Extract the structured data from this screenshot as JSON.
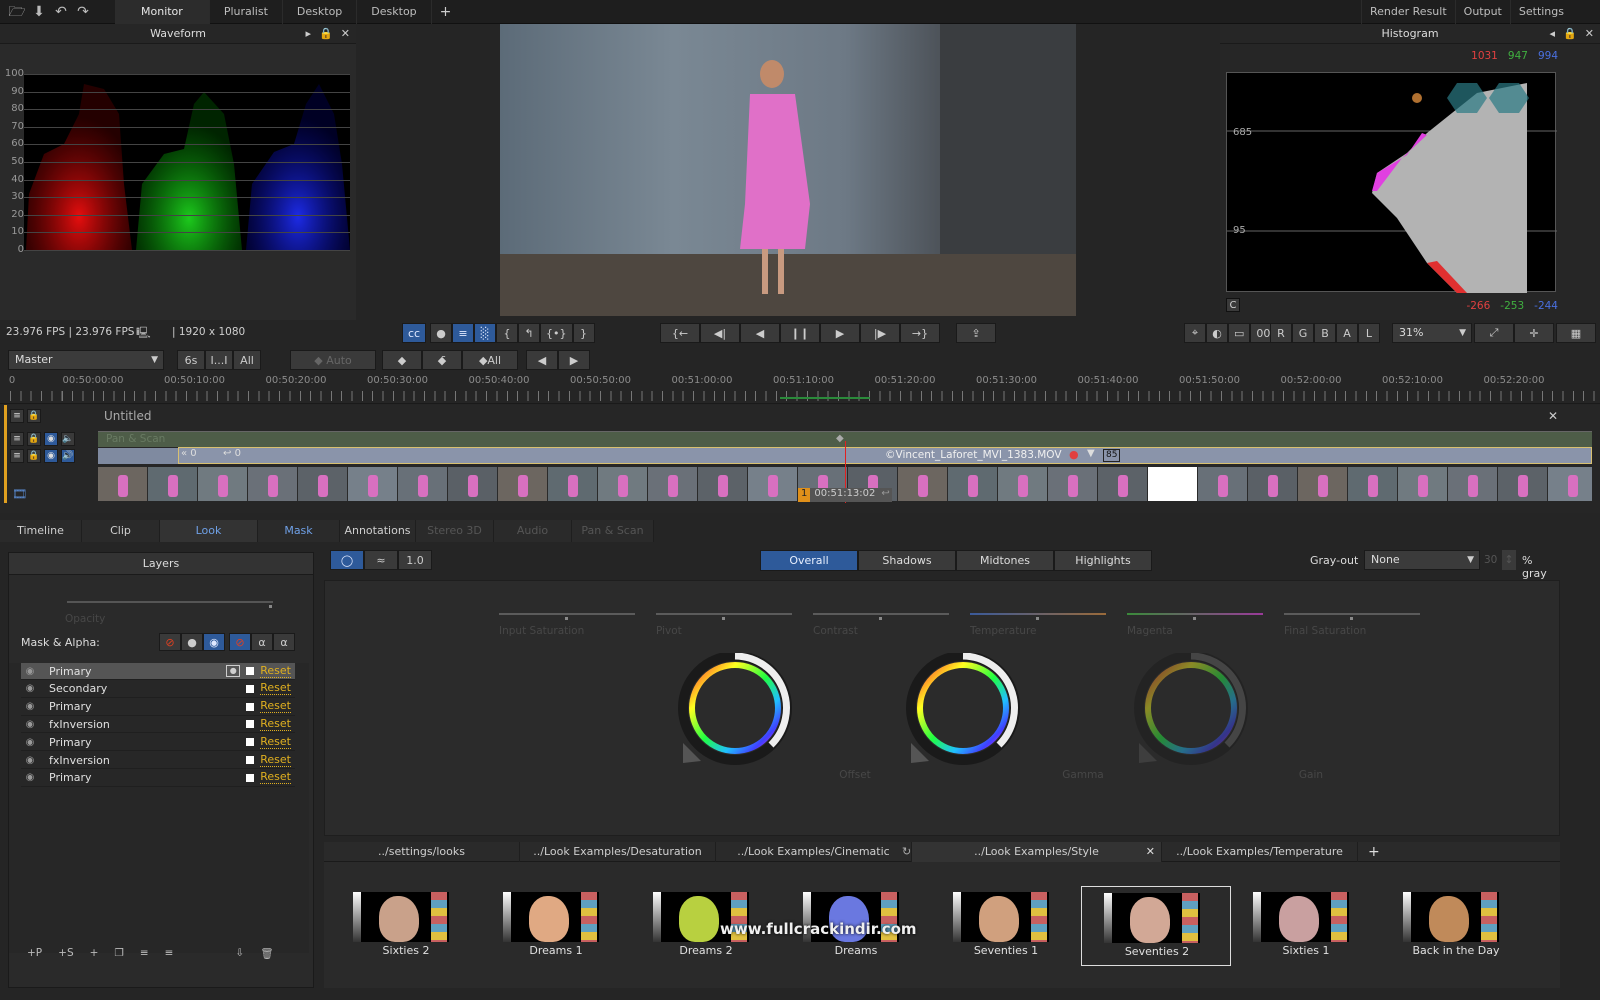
{
  "app": {
    "workspace_tabs": [
      "Monitor",
      "Pluralist",
      "Desktop",
      "Desktop"
    ],
    "active_workspace": "Monitor",
    "right_tabs": [
      "Render Result",
      "Output",
      "Settings"
    ]
  },
  "waveform": {
    "title": "Waveform",
    "scale": [
      "100",
      "90",
      "80",
      "70",
      "60",
      "50",
      "40",
      "30",
      "20",
      "10",
      "0"
    ]
  },
  "histogram": {
    "title": "Histogram",
    "top_values": {
      "r": "1031",
      "g": "947",
      "b": "994"
    },
    "bottom_values": {
      "r": "-266",
      "g": "-253",
      "b": "-244"
    },
    "marks": [
      "685",
      "95"
    ],
    "c_button": "C",
    "colors": {
      "r": "#e04040",
      "g": "#40b040",
      "b": "#4a70e0"
    }
  },
  "status": {
    "fps": "23.976 FPS  |  23.976 FPS",
    "resolution": "|  1920 x 1080",
    "channels": [
      "R",
      "G",
      "B",
      "A",
      "L"
    ],
    "zoom": "31%"
  },
  "keyframes": {
    "layer_select": "Master",
    "range_buttons": [
      "6s",
      "I...I",
      "All"
    ],
    "auto_label": "Auto",
    "all_label": "All"
  },
  "ruler": {
    "labels": [
      "0",
      "00:50:00:00",
      "00:50:10:00",
      "00:50:20:00",
      "00:50:30:00",
      "00:50:40:00",
      "00:50:50:00",
      "00:51:00:00",
      "00:51:10:00",
      "00:51:20:00",
      "00:51:30:00",
      "00:51:40:00",
      "00:51:50:00",
      "00:52:00:00",
      "00:52:10:00",
      "00:52:20:00"
    ]
  },
  "timeline": {
    "name": "Untitled",
    "pan_scan_label": "Pan & Scan",
    "clip_name": "©Vincent_Laforet_MVI_1383.MOV",
    "clip_badge": "85",
    "clip_offset_left": "0",
    "clip_offset_right": "0",
    "playhead_index": "1",
    "playhead_tc": "00:51:13:02"
  },
  "bottom_tabs": [
    {
      "label": "Timeline",
      "state": "normal"
    },
    {
      "label": "Clip",
      "state": "normal"
    },
    {
      "label": "Look",
      "state": "active"
    },
    {
      "label": "Mask",
      "state": "blue"
    },
    {
      "label": "Annotations",
      "state": "normal"
    },
    {
      "label": "Stereo 3D",
      "state": "dim"
    },
    {
      "label": "Audio",
      "state": "dim"
    },
    {
      "label": "Pan & Scan",
      "state": "dim"
    }
  ],
  "layers": {
    "title": "Layers",
    "opacity_label": "Opacity",
    "mask_alpha_label": "Mask & Alpha:",
    "items": [
      {
        "name": "Primary",
        "selected": true
      },
      {
        "name": "Secondary",
        "selected": false
      },
      {
        "name": "Primary",
        "selected": false
      },
      {
        "name": "fxInversion",
        "selected": false
      },
      {
        "name": "Primary",
        "selected": false
      },
      {
        "name": "fxInversion",
        "selected": false
      },
      {
        "name": "Primary",
        "selected": false
      }
    ],
    "reset_label": "Reset",
    "footer_buttons": [
      "+P",
      "+S"
    ]
  },
  "look": {
    "ranges": [
      "Overall",
      "Shadows",
      "Midtones",
      "Highlights"
    ],
    "active_range": "Overall",
    "grayout_label": "Gray-out",
    "grayout_value": "None",
    "gray_percent": "30",
    "gray_suffix": "% gray",
    "sliders": [
      "Input Saturation",
      "Pivot",
      "Contrast",
      "Temperature",
      "Magenta",
      "Final Saturation"
    ],
    "wheels": [
      "Offset",
      "Gamma",
      "Gain"
    ]
  },
  "library": {
    "tabs": [
      "../settings/looks",
      "../Look Examples/Desaturation",
      "../Look Examples/Cinematic",
      "../Look Examples/Style",
      "../Look Examples/Temperature"
    ],
    "active_tab": "../Look Examples/Style",
    "looks": [
      {
        "name": "Sixties 2",
        "tone": "#c9a18a",
        "selected": false
      },
      {
        "name": "Dreams 1",
        "tone": "#e0a983",
        "selected": false
      },
      {
        "name": "Dreams 2",
        "tone": "#b8d040",
        "selected": false
      },
      {
        "name": "Dreams",
        "tone": "#6a78e0",
        "selected": false
      },
      {
        "name": "Seventies 1",
        "tone": "#d0a07e",
        "selected": false
      },
      {
        "name": "Seventies 2",
        "tone": "#d2a896",
        "selected": true
      },
      {
        "name": "Sixties 1",
        "tone": "#c9a0a0",
        "selected": false
      },
      {
        "name": "Back in the Day",
        "tone": "#c08a5a",
        "selected": false
      }
    ]
  },
  "watermark": "www.fullcrackindir.com"
}
